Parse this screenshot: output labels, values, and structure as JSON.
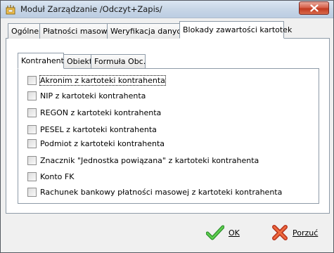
{
  "window": {
    "title": "Moduł Zarządzanie /Odczyt+Zapis/"
  },
  "tabs": [
    {
      "label": "Ogólne"
    },
    {
      "label": "Płatności masowe"
    },
    {
      "label": "Weryfikacja danych"
    },
    {
      "label": "Blokady zawartości kartotek"
    }
  ],
  "inner_tabs": [
    {
      "label": "Kontrahent"
    },
    {
      "label": "Obiekt"
    },
    {
      "label": "Formuła Obc."
    }
  ],
  "checkboxes": [
    {
      "label": "Akronim z kartoteki kontrahenta",
      "checked": false
    },
    {
      "label": "NIP z kartoteki kontrahenta",
      "checked": false
    },
    {
      "label": "REGON z kartoteki kontrahenta",
      "checked": false
    },
    {
      "label": "PESEL z kartoteki kontrahenta",
      "checked": false
    },
    {
      "label": "Podmiot z kartoteki kontrahenta",
      "checked": false
    },
    {
      "label": "Znacznik \"Jednostka powiązana\"  z kartoteki kontrahenta",
      "checked": false
    },
    {
      "label": "Konto FK",
      "checked": false
    },
    {
      "label": "Rachunek bankowy płatności masowej z kartoteki kontrahenta",
      "checked": false
    }
  ],
  "buttons": {
    "ok_label": "OK",
    "cancel_label": "Porzuć"
  },
  "colors": {
    "ok_icon": "#3aa53a",
    "cancel_icon": "#e0452a"
  }
}
